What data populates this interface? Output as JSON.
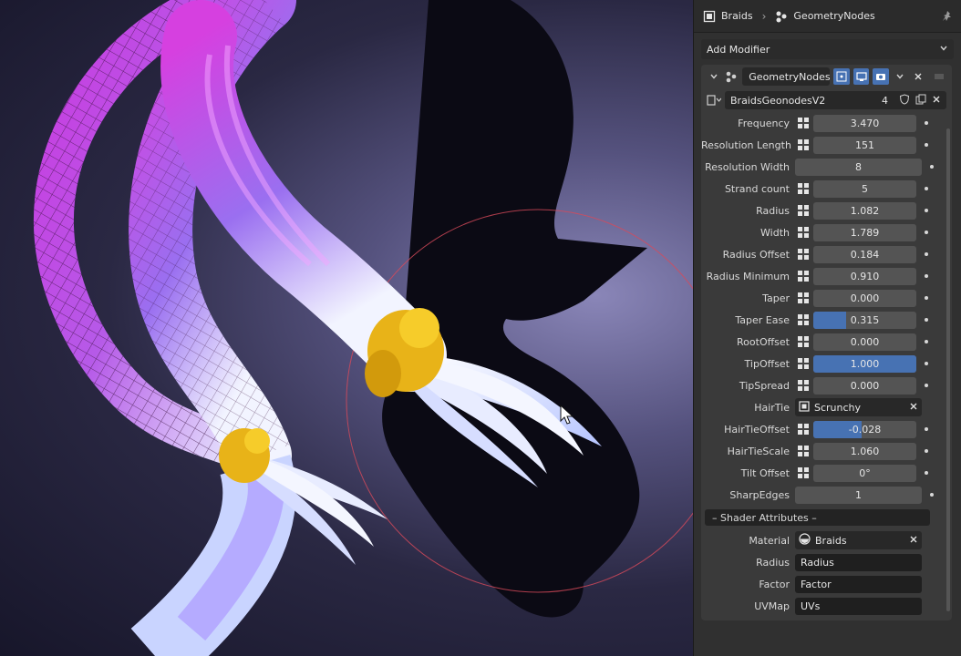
{
  "breadcrumb": {
    "object": "Braids",
    "modifier": "GeometryNodes"
  },
  "add_modifier": {
    "label": "Add Modifier"
  },
  "modifier": {
    "name": "GeometryNodes"
  },
  "node_group": {
    "name": "BraidsGeonodesV2",
    "users": "4"
  },
  "properties": [
    {
      "label": "Frequency",
      "value": "3.470",
      "fill": 0
    },
    {
      "label": "Resolution Length",
      "value": "151",
      "fill": 0
    },
    {
      "label": "Resolution Width",
      "value": "8",
      "fill": 0,
      "no_attr": true
    },
    {
      "label": "Strand count",
      "value": "5",
      "fill": 0
    },
    {
      "label": "Radius",
      "value": "1.082",
      "fill": 0
    },
    {
      "label": "Width",
      "value": "1.789",
      "fill": 0
    },
    {
      "label": "Radius Offset",
      "value": "0.184",
      "fill": 0
    },
    {
      "label": "Radius Minimum",
      "value": "0.910",
      "fill": 0
    },
    {
      "label": "Taper",
      "value": "0.000",
      "fill": 0
    },
    {
      "label": "Taper Ease",
      "value": "0.315",
      "fill": 0.315
    },
    {
      "label": "RootOffset",
      "value": "0.000",
      "fill": 0
    },
    {
      "label": "TipOffset",
      "value": "1.000",
      "fill": 1.0
    },
    {
      "label": "TipSpread",
      "value": "0.000",
      "fill": 0
    }
  ],
  "hairtie": {
    "label": "HairTie",
    "value": "Scrunchy"
  },
  "properties2": [
    {
      "label": "HairTieOffset",
      "value": "-0.028",
      "fill": 0.47
    },
    {
      "label": "HairTieScale",
      "value": "1.060",
      "fill": 0
    },
    {
      "label": "Tilt Offset",
      "value": "0°",
      "fill": 0
    },
    {
      "label": "SharpEdges",
      "value": "1",
      "fill": 0,
      "no_attr": true
    }
  ],
  "shader_section": {
    "label": "– Shader Attributes –"
  },
  "material": {
    "label": "Material",
    "value": "Braids"
  },
  "string_props": [
    {
      "label": "Radius",
      "value": "Radius"
    },
    {
      "label": "Factor",
      "value": "Factor"
    },
    {
      "label": "UVMap",
      "value": "UVs"
    }
  ],
  "colors": {
    "accent": "#4772b3",
    "panel": "#303030",
    "field": "#545454"
  }
}
